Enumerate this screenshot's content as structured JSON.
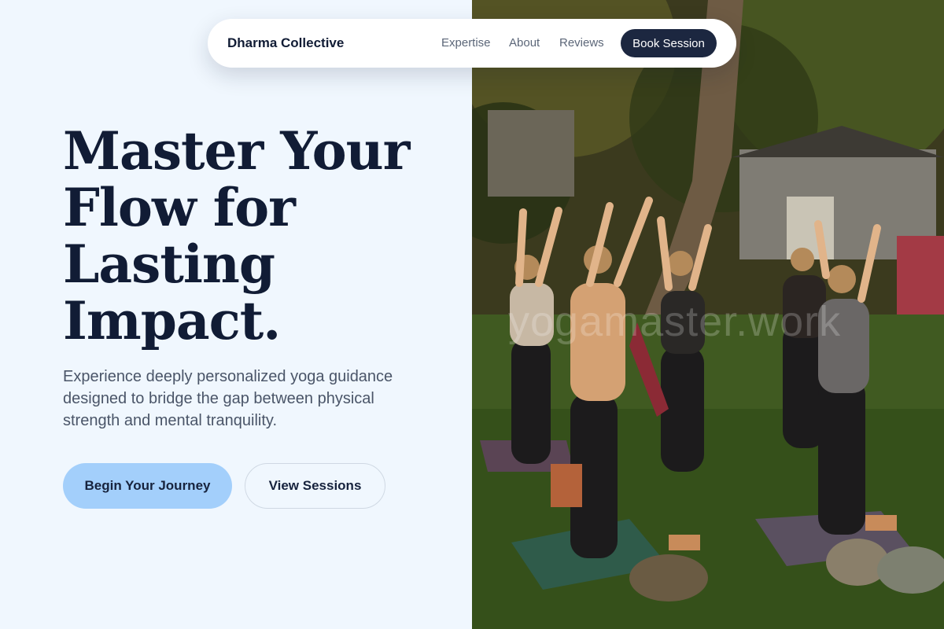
{
  "nav": {
    "brand": "Dharma Collective",
    "links": [
      "Expertise",
      "About",
      "Reviews"
    ],
    "cta": "Book Session"
  },
  "hero": {
    "headline_lines": [
      "Master Your",
      "Flow for",
      "Lasting",
      "Impact."
    ],
    "lede": "Experience deeply personalized yoga guidance designed to bridge the gap between physical strength and mental tranquility.",
    "primary_button": "Begin Your Journey",
    "secondary_button": "View Sessions"
  },
  "photo": {
    "watermark": "yogamaster.work"
  },
  "colors": {
    "page_bg": "#f0f7fe",
    "primary_button_bg": "#a3cffb",
    "nav_cta_bg": "#1c2740",
    "heading_text": "#111c35"
  }
}
